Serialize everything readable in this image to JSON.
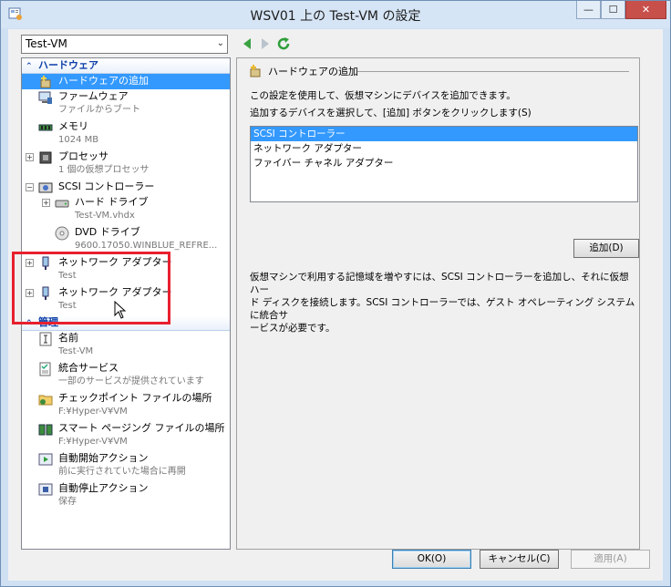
{
  "window": {
    "title": "WSV01 上の Test-VM の設定"
  },
  "controls": {
    "minimize": "—",
    "maximize": "☐",
    "close": "✕"
  },
  "vm_select": {
    "value": "Test-VM"
  },
  "tree": {
    "hardware_header": "ハードウェア",
    "management_header": "管理",
    "hardware": [
      {
        "name": "ハードウェアの追加",
        "sub": ""
      },
      {
        "name": "ファームウェア",
        "sub": "ファイルからブート"
      },
      {
        "name": "メモリ",
        "sub": "1024 MB"
      },
      {
        "name": "プロセッサ",
        "sub": "1 個の仮想プロセッサ"
      },
      {
        "name": "SCSI コントローラー",
        "sub": ""
      },
      {
        "name": "ハード ドライブ",
        "sub": "Test-VM.vhdx"
      },
      {
        "name": "DVD ドライブ",
        "sub": "9600.17050.WINBLUE_REFRE..."
      },
      {
        "name": "ネットワーク アダプター",
        "sub": "Test"
      },
      {
        "name": "ネットワーク アダプター",
        "sub": "Test"
      }
    ],
    "management": [
      {
        "name": "名前",
        "sub": "Test-VM"
      },
      {
        "name": "統合サービス",
        "sub": "一部のサービスが提供されています"
      },
      {
        "name": "チェックポイント ファイルの場所",
        "sub": "F:¥Hyper-V¥VM"
      },
      {
        "name": "スマート ページング ファイルの場所",
        "sub": "F:¥Hyper-V¥VM"
      },
      {
        "name": "自動開始アクション",
        "sub": "前に実行されていた場合に再開"
      },
      {
        "name": "自動停止アクション",
        "sub": "保存"
      }
    ]
  },
  "panel": {
    "title": "ハードウェアの追加",
    "intro": "この設定を使用して、仮想マシンにデバイスを追加できます。",
    "instruction": "追加するデバイスを選択して、[追加] ボタンをクリックします(S)",
    "devices": [
      "SCSI コントローラー",
      "ネットワーク アダプター",
      "ファイバー チャネル アダプター"
    ],
    "add_button": "追加(D)",
    "description_1": "仮想マシンで利用する記憶域を増やすには、SCSI コントローラーを追加し、それに仮想ハー",
    "description_2": "ド ディスクを接続します。SCSI コントローラーでは、ゲスト オペレーティング システムに統合サ",
    "description_3": "ービスが必要です。"
  },
  "footer": {
    "ok": "OK(O)",
    "cancel": "キャンセル(C)",
    "apply": "適用(A)"
  },
  "colors": {
    "selection": "#3399ff",
    "highlight": "#e8202e",
    "header_text": "#0b3ea8"
  }
}
